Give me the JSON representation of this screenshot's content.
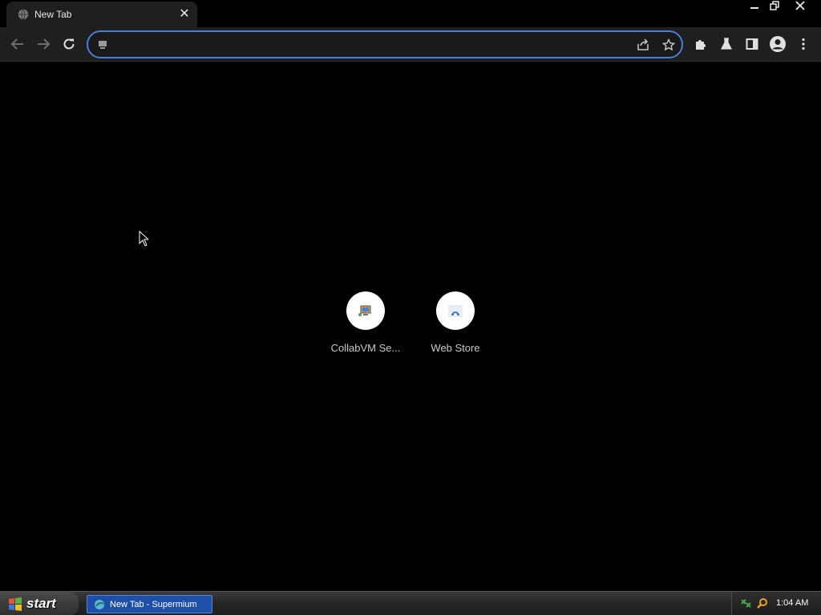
{
  "browser": {
    "tab": {
      "title": "New Tab",
      "close_icon": "close-icon"
    },
    "window_controls": {
      "minimize": "minimize-icon",
      "restore": "restore-icon",
      "close": "close-icon"
    },
    "toolbar": {
      "back_icon": "arrow-left-icon",
      "forward_icon": "arrow-right-icon",
      "reload_icon": "reload-icon",
      "omnibox": {
        "value": "",
        "placeholder": ""
      },
      "share_icon": "share-icon",
      "bookmark_icon": "star-icon",
      "extensions_icon": "puzzle-icon",
      "labs_icon": "flask-icon",
      "side_panel_icon": "side-panel-icon",
      "profile_icon": "avatar-icon",
      "menu_icon": "kebab-menu-icon"
    }
  },
  "new_tab": {
    "shortcuts": [
      {
        "label": "CollabVM Se...",
        "icon": "collabvm-icon"
      },
      {
        "label": "Web Store",
        "icon": "webstore-icon"
      }
    ]
  },
  "taskbar": {
    "start_label": "start",
    "task": {
      "label": "New Tab - Supermium"
    },
    "clock": "1:04 AM"
  },
  "colors": {
    "accent": "#4a7fd6",
    "toolbar_bg": "#1f1f1f",
    "content_bg": "#000000"
  }
}
